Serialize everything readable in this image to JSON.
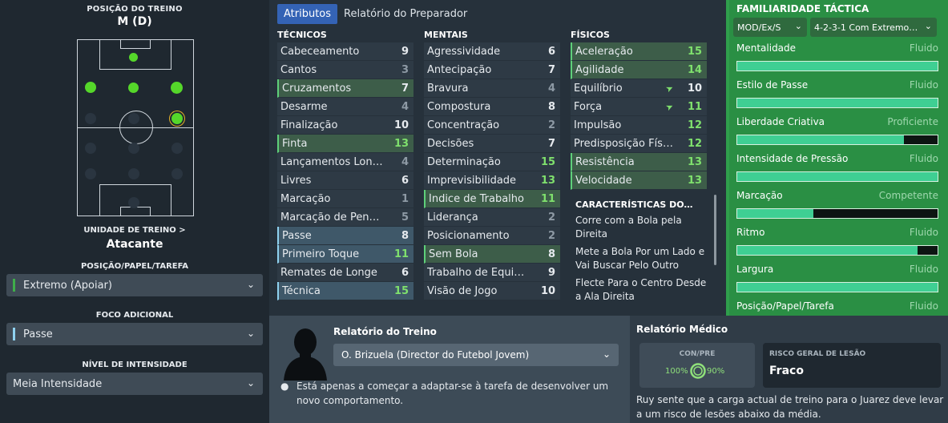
{
  "left": {
    "title": "POSIÇÃO DO TREINO",
    "position": "M (D)",
    "unit_label": "UNIDADE DE TREINO >",
    "unit": "Atacante",
    "role_label": "POSIÇÃO/PAPEL/TAREFA",
    "role_value": "Extremo (Apoiar)",
    "focus_label": "FOCO ADICIONAL",
    "focus_value": "Passe",
    "intensity_label": "NÍVEL DE INTENSIDADE",
    "intensity_value": "Meia Intensidade"
  },
  "tabs": [
    "Atributos",
    "Relatório do Preparador"
  ],
  "columns": {
    "tecnicos": {
      "header": "TÉCNICOS",
      "rows": [
        {
          "name": "Cabeceamento",
          "value": "9",
          "tone": "w",
          "hl": ""
        },
        {
          "name": "Cantos",
          "value": "3",
          "tone": "d",
          "hl": ""
        },
        {
          "name": "Cruzamentos",
          "value": "7",
          "tone": "w",
          "hl": "green"
        },
        {
          "name": "Desarme",
          "value": "4",
          "tone": "d",
          "hl": ""
        },
        {
          "name": "Finalização",
          "value": "10",
          "tone": "w",
          "hl": ""
        },
        {
          "name": "Finta",
          "value": "13",
          "tone": "g",
          "hl": "green"
        },
        {
          "name": "Lançamentos Lon…",
          "value": "4",
          "tone": "d",
          "hl": ""
        },
        {
          "name": "Livres",
          "value": "6",
          "tone": "w",
          "hl": ""
        },
        {
          "name": "Marcação",
          "value": "1",
          "tone": "d",
          "hl": ""
        },
        {
          "name": "Marcação de Pen…",
          "value": "5",
          "tone": "d",
          "hl": ""
        },
        {
          "name": "Passe",
          "value": "8",
          "tone": "w",
          "hl": "blue"
        },
        {
          "name": "Primeiro Toque",
          "value": "11",
          "tone": "g",
          "hl": "blue"
        },
        {
          "name": "Remates de Longe",
          "value": "6",
          "tone": "w",
          "hl": ""
        },
        {
          "name": "Técnica",
          "value": "15",
          "tone": "g",
          "hl": "blue"
        }
      ]
    },
    "mentais": {
      "header": "MENTAIS",
      "rows": [
        {
          "name": "Agressividade",
          "value": "6",
          "tone": "w",
          "hl": ""
        },
        {
          "name": "Antecipação",
          "value": "7",
          "tone": "w",
          "hl": ""
        },
        {
          "name": "Bravura",
          "value": "4",
          "tone": "d",
          "hl": ""
        },
        {
          "name": "Compostura",
          "value": "8",
          "tone": "w",
          "hl": ""
        },
        {
          "name": "Concentração",
          "value": "2",
          "tone": "d",
          "hl": ""
        },
        {
          "name": "Decisões",
          "value": "7",
          "tone": "w",
          "hl": ""
        },
        {
          "name": "Determinação",
          "value": "15",
          "tone": "g",
          "hl": ""
        },
        {
          "name": "Imprevisibilidade",
          "value": "13",
          "tone": "g",
          "hl": ""
        },
        {
          "name": "Índice de Trabalho",
          "value": "11",
          "tone": "g",
          "hl": "green"
        },
        {
          "name": "Liderança",
          "value": "2",
          "tone": "d",
          "hl": ""
        },
        {
          "name": "Posicionamento",
          "value": "2",
          "tone": "d",
          "hl": ""
        },
        {
          "name": "Sem Bola",
          "value": "8",
          "tone": "w",
          "hl": "green"
        },
        {
          "name": "Trabalho de Equi…",
          "value": "9",
          "tone": "w",
          "hl": ""
        },
        {
          "name": "Visão de Jogo",
          "value": "10",
          "tone": "w",
          "hl": ""
        }
      ]
    },
    "fisicos": {
      "header": "FÍSICOS",
      "rows": [
        {
          "name": "Aceleração",
          "value": "15",
          "tone": "g",
          "hl": "green",
          "arrow": ""
        },
        {
          "name": "Agilidade",
          "value": "14",
          "tone": "g",
          "hl": "green",
          "arrow": ""
        },
        {
          "name": "Equilíbrio",
          "value": "10",
          "tone": "w",
          "hl": "",
          "arrow": "➤"
        },
        {
          "name": "Força",
          "value": "11",
          "tone": "g",
          "hl": "",
          "arrow": "➤"
        },
        {
          "name": "Impulsão",
          "value": "12",
          "tone": "g",
          "hl": "",
          "arrow": ""
        },
        {
          "name": "Predisposição Fís…",
          "value": "12",
          "tone": "g",
          "hl": "",
          "arrow": ""
        },
        {
          "name": "Resistência",
          "value": "13",
          "tone": "g",
          "hl": "green",
          "arrow": ""
        },
        {
          "name": "Velocidade",
          "value": "13",
          "tone": "g",
          "hl": "green",
          "arrow": ""
        }
      ]
    }
  },
  "characteristics": {
    "title": "CARACTERÍSTICAS DO…",
    "items": [
      "Corre com a Bola pela Direita",
      "Mete a Bola Por um Lado e Vai Buscar Pelo Outro",
      "Flecte Para o Centro Desde a Ala Direita"
    ]
  },
  "tactical": {
    "title": "FAMILIARIDADE TÁCTICA",
    "mentality_select": "MOD/Ex/S",
    "formation_select": "4-2-3-1 Com Extremo…",
    "rows": [
      {
        "label": "Mentalidade",
        "value": "Fluido",
        "level": 1.0
      },
      {
        "label": "Estilo de Passe",
        "value": "Fluido",
        "level": 1.0
      },
      {
        "label": "Liberdade Criativa",
        "value": "Proficiente",
        "level": 0.83
      },
      {
        "label": "Intensidade de Pressão",
        "value": "Fluido",
        "level": 1.0
      },
      {
        "label": "Marcação",
        "value": "Competente",
        "level": 0.38
      },
      {
        "label": "Ritmo",
        "value": "Fluido",
        "level": 0.9
      },
      {
        "label": "Largura",
        "value": "Fluido",
        "level": 1.0
      },
      {
        "label": "Posição/Papel/Tarefa",
        "value": "Fluido",
        "level": 1.0
      }
    ]
  },
  "training_report": {
    "title": "Relatório do Treino",
    "coach": "O. Brizuela (Director do Futebol Jovem)",
    "note": "Está apenas a começar a adaptar-se à tarefa de desenvolver um novo comportamento."
  },
  "medical": {
    "title": "Relatório Médico",
    "conpre_label": "CON/PRE",
    "con_value": "100%",
    "pre_value": "90%",
    "risk_label": "RISCO GERAL DE LESÃO",
    "risk_value": "Fraco",
    "text": "Ruy sente que a carga actual de treino para o Juarez deve levar a um risco de lesões abaixo da média."
  },
  "colors": {
    "accent_green": "#55d72a",
    "tab_blue": "#3463b5",
    "tactical_bg": "#2a8f44",
    "bar_fill": "#3fcf93"
  }
}
